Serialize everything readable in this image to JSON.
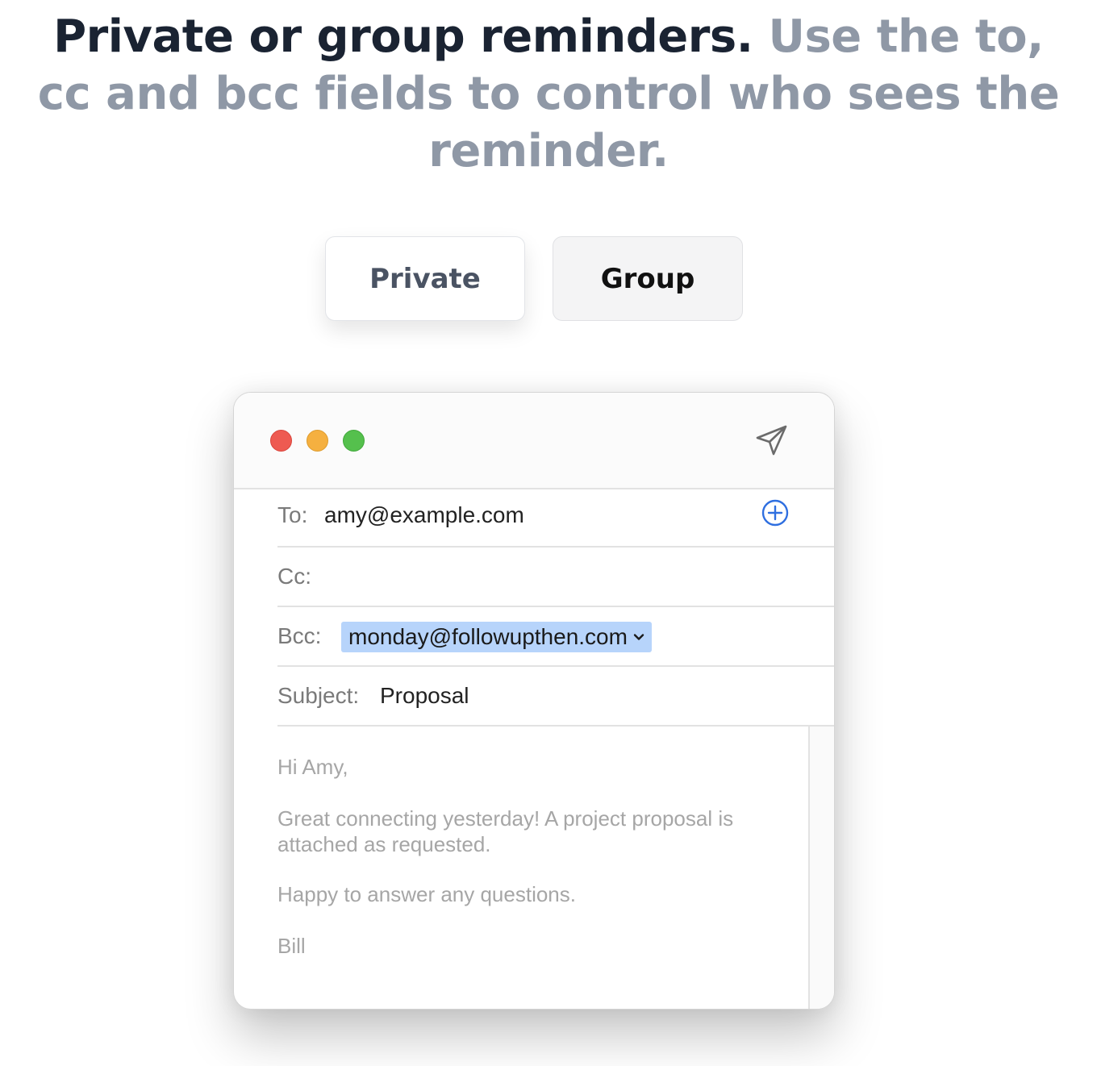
{
  "heading": {
    "strong": "Private or group reminders.",
    "muted": "Use the to, cc and bcc fields to control who sees the reminder."
  },
  "toggle": {
    "private_label": "Private",
    "group_label": "Group",
    "selected": "Private"
  },
  "mail": {
    "window_controls": [
      "close",
      "minimize",
      "zoom"
    ],
    "send_icon": "paper-plane-icon",
    "add_icon": "plus-circle-icon",
    "to_label": "To:",
    "to_value": "amy@example.com",
    "cc_label": "Cc:",
    "cc_value": "",
    "bcc_label": "Bcc:",
    "bcc_value": "monday@followupthen.com",
    "subject_label": "Subject:",
    "subject_value": "Proposal",
    "body": [
      "Hi Amy,",
      "Great connecting yesterday! A project proposal is attached as requested.",
      "Happy to answer any questions.",
      "Bill"
    ]
  },
  "colors": {
    "heading_strong": "#1a2332",
    "heading_muted": "#8f98a6",
    "token_bg": "#b7d4fb",
    "accent_blue": "#2f6fe0",
    "light_red": "#ee5a51",
    "light_yellow": "#f5b040",
    "light_green": "#55c04d"
  }
}
